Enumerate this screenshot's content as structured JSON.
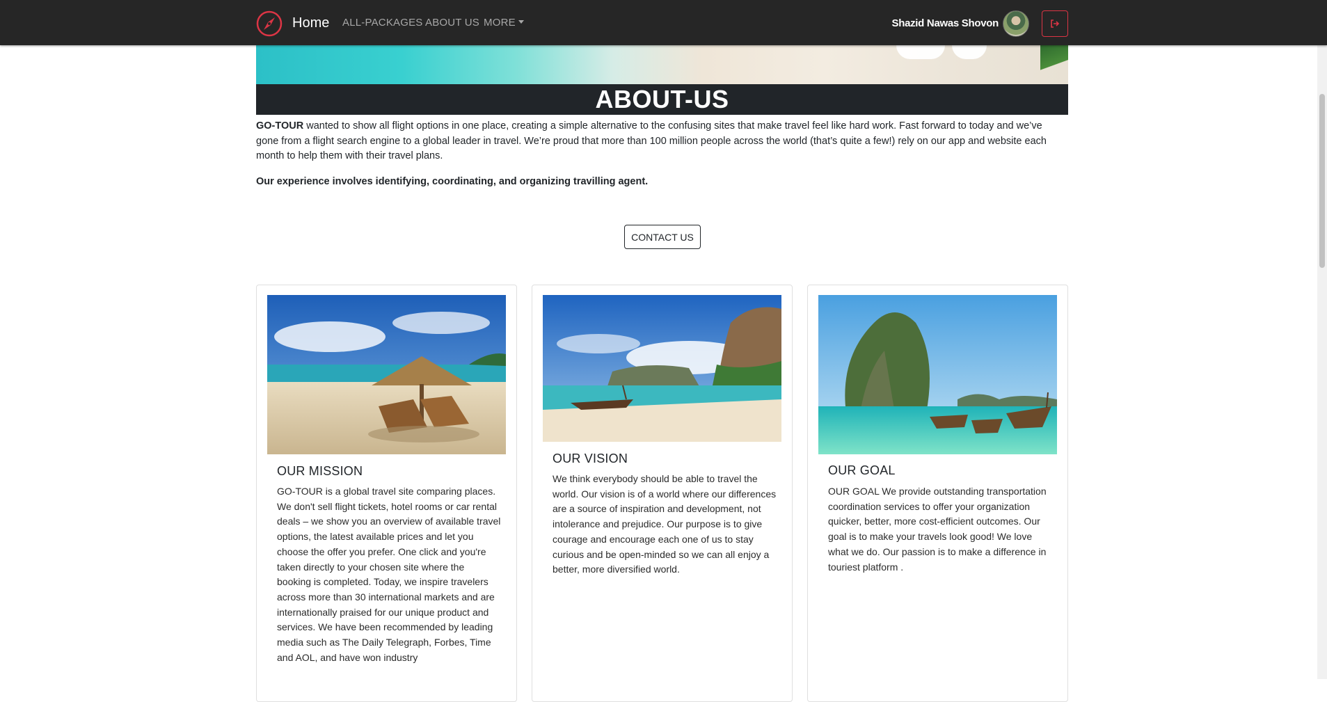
{
  "navbar": {
    "brand": "Home",
    "links": [
      "ALL-PACKAGES",
      "ABOUT US",
      "MORE"
    ],
    "user_name": "Shazid Nawas Shovon",
    "logout_icon": "sign-out-icon",
    "accent_color": "#dc3545"
  },
  "page": {
    "title": "ABOUT-US",
    "intro_brand": "GO-TOUR",
    "intro_text": " wanted to show all flight options in one place, creating a simple alternative to the confusing sites that make travel feel like hard work. Fast forward to today and we’ve gone from a flight search engine to a global leader in travel. We’re proud that more than 100 million people across the world (that’s quite a few!) rely on our app and website each month to help them with their travel plans.",
    "experience": "Our experience involves identifying, coordinating, and organizing travilling agent.",
    "contact_button": "CONTACT US"
  },
  "cards": [
    {
      "title": "OUR MISSION",
      "text": "GO-TOUR is a global travel site comparing places. We don't sell flight tickets, hotel rooms or car rental deals – we show you an overview of available travel options, the latest available prices and let you choose the offer you prefer. One click and you're taken directly to your chosen site where the booking is completed. Today, we inspire travelers across more than 30 international markets and are internationally praised for our unique product and services. We have been recommended by leading media such as The Daily Telegraph, Forbes, Time and AOL, and have won industry"
    },
    {
      "title": "OUR VISION",
      "text": "We think everybody should be able to travel the world. Our vision is of a world where our differences are a source of inspiration and development, not intolerance and prejudice. Our purpose is to give courage and encourage each one of us to stay curious and be open-minded so we can all enjoy a better, more diversified world."
    },
    {
      "title": "OUR GOAL",
      "text": "OUR GOAL We provide outstanding transportation coordination services to offer your organization quicker, better, more cost-efficient outcomes. Our goal is to make your travels look good! We love what we do. Our passion is to make a difference in touriest platform ."
    }
  ]
}
